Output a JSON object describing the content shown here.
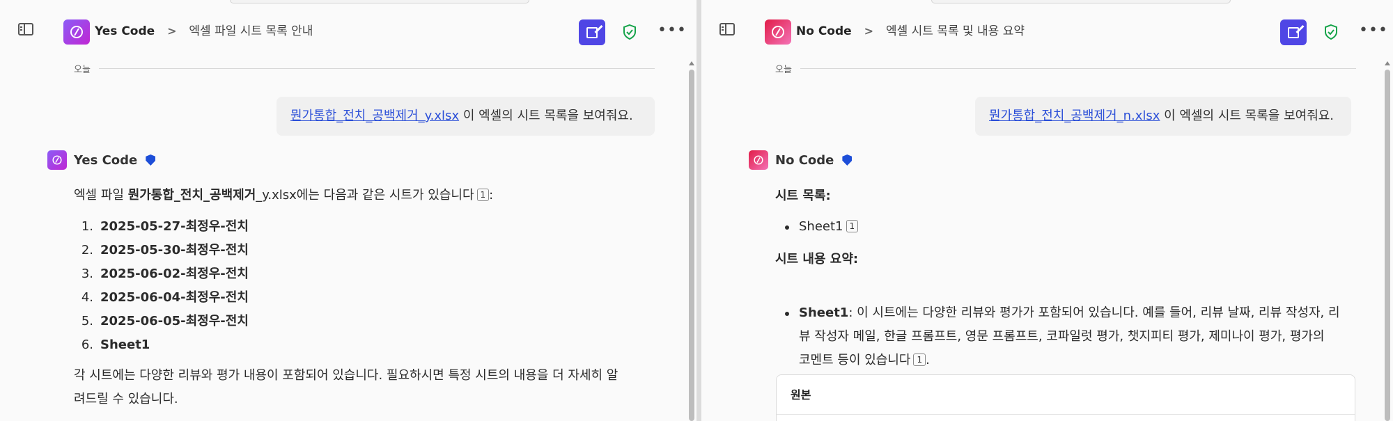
{
  "left": {
    "app_name": "Yes Code",
    "breadcrumb_sep": ">",
    "chat_title": "엑셀 파일 시트 목록 안내",
    "date_label": "오늘",
    "user_message": {
      "file_link": "뭔가통합_전치_공백제거_y.xlsx",
      "text": " 이 엑셀의 시트 목록을 보여줘요."
    },
    "bot_name": "Yes Code",
    "intro": {
      "before": "엑셀 파일 ",
      "file_bold": "뭔가통합_전치_공백제거",
      "file_tail": "_y.xlsx에는 다음과 같은 시트가 있습니다",
      "cite": "1",
      "after": ":"
    },
    "sheets": [
      {
        "num": "1.",
        "name": "2025-05-27-최정우-전치"
      },
      {
        "num": "2.",
        "name": "2025-05-30-최정우-전치"
      },
      {
        "num": "3.",
        "name": "2025-06-02-최정우-전치"
      },
      {
        "num": "4.",
        "name": "2025-06-04-최정우-전치"
      },
      {
        "num": "5.",
        "name": "2025-06-05-최정우-전치"
      },
      {
        "num": "6.",
        "name": "Sheet1"
      }
    ],
    "closing_line1": "각 시트에는 다양한 리뷰와 평가 내용이 포함되어 있습니다. 필요하시면 특정 시트의 내용을 더 자세히 알",
    "closing_line2": "려드릴 수 있습니다."
  },
  "right": {
    "app_name": "No Code",
    "breadcrumb_sep": ">",
    "chat_title": "엑셀 시트 목록 및 내용 요약",
    "date_label": "오늘",
    "user_message": {
      "file_link": "뭔가통합_전치_공백제거_n.xlsx",
      "text": " 이 엑셀의 시트 목록을 보여줘요."
    },
    "bot_name": "No Code",
    "sheet_list_heading": "시트 목록:",
    "sheet_list_item": "Sheet1",
    "sheet_list_cite": "1",
    "summary_heading": "시트 내용 요약:",
    "summary_label": "Sheet1",
    "summary_line1": ": 이 시트에는 다양한 리뷰와 평가가 포함되어 있습니다. 예를 들어, 리뷰 날짜, 리뷰 작성자, 리",
    "summary_line2": "뷰 작성자 메일, 한글 프롬프트, 영문 프롬프트, 코파일럿 평가, 챗지피티 평가, 제미나이 평가, 평가의",
    "summary_line3": "코멘트 등이 있습니다",
    "summary_cite": "1",
    "summary_end": ".",
    "card_title": "원본"
  },
  "icons": {
    "sidebar": "sidebar-toggle-icon",
    "new_chat": "compose-icon",
    "shield": "shield-check-icon",
    "more": "more-horizontal-icon",
    "app_logo": "code-slash-logo"
  },
  "colors": {
    "accent": "#4f46e5",
    "link": "#2b4fd8",
    "shield_green": "#16a34a",
    "badge_blue": "#1d4ed8"
  }
}
